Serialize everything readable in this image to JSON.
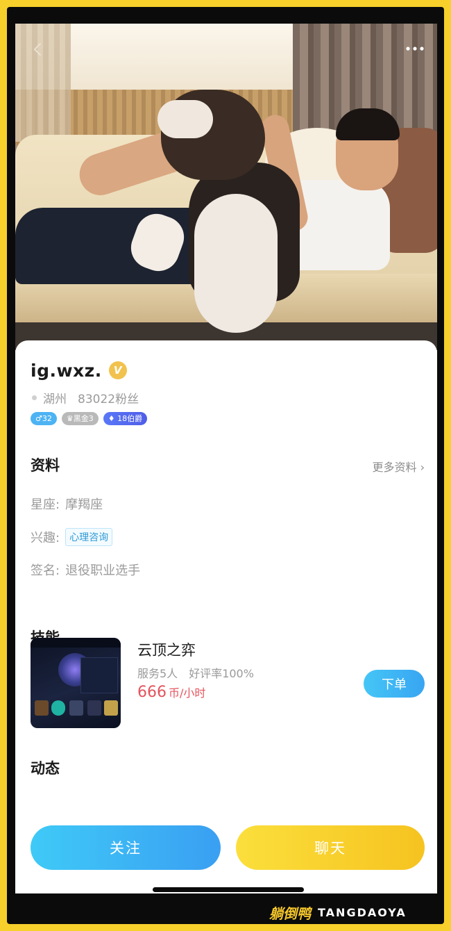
{
  "header": {
    "back_icon": "chevron-left-icon",
    "more_icon": "more-dots-icon"
  },
  "profile": {
    "username": "ig.wxz.",
    "vip_badge": "V",
    "location": "湖州",
    "followers": "83022粉丝",
    "tags": {
      "gender_age": "♂32",
      "rank": "黑金3",
      "level": "18伯爵"
    }
  },
  "info": {
    "title": "资料",
    "more_label": "更多资料 ›",
    "zodiac_label": "星座:",
    "zodiac_value": "摩羯座",
    "interest_label": "兴趣:",
    "interest_value": "心理咨询",
    "signature_label": "签名:",
    "signature_value": "退役职业选手"
  },
  "skills": {
    "title": "技能",
    "items": [
      {
        "name": "云顶之弈",
        "served": "服务5人",
        "rating": "好评率100%",
        "price": "666",
        "unit": "币/小时",
        "order_label": "下单"
      }
    ]
  },
  "feed": {
    "title": "动态"
  },
  "actions": {
    "follow_label": "关注",
    "chat_label": "聊天"
  },
  "watermark": {
    "cn": "躺倒鸭",
    "en": "TANGDAOYA"
  },
  "colors": {
    "follow": "#3aa8f4",
    "chat": "#f8cf2a",
    "price": "#e4545d",
    "border": "#f7d02c"
  }
}
